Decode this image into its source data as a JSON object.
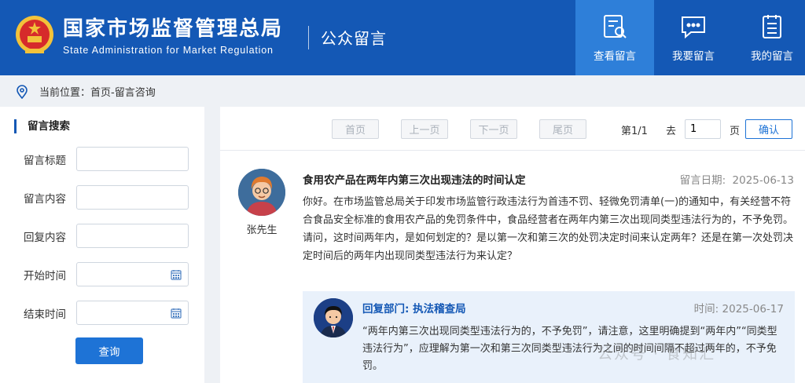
{
  "header": {
    "site_title": "国家市场监督管理总局",
    "site_subtitle": "State Administration for Market Regulation",
    "section_title": "公众留言",
    "nav": [
      {
        "label": "查看留言",
        "icon": "search-doc-icon",
        "active": true
      },
      {
        "label": "我要留言",
        "icon": "chat-bubble-icon",
        "active": false
      },
      {
        "label": "我的留言",
        "icon": "clipboard-list-icon",
        "active": false
      }
    ],
    "colors": {
      "header_bg": "#1458b5",
      "active_nav": "#2e7fd9",
      "accent": "#1e73d6"
    }
  },
  "breadcrumb": {
    "icon": "location-pin-icon",
    "text": "当前位置：首页-留言咨询"
  },
  "sidebar": {
    "title": "留言搜索",
    "fields": [
      {
        "label": "留言标题",
        "value": "",
        "type": "text"
      },
      {
        "label": "留言内容",
        "value": "",
        "type": "text"
      },
      {
        "label": "回复内容",
        "value": "",
        "type": "text"
      },
      {
        "label": "开始时间",
        "value": "",
        "type": "date",
        "icon": "calendar-icon"
      },
      {
        "label": "结束时间",
        "value": "",
        "type": "date",
        "icon": "calendar-icon"
      }
    ],
    "query_label": "查询"
  },
  "pager": {
    "first": "首页",
    "prev": "上一页",
    "next": "下一页",
    "last": "尾页",
    "page_info": "第1/1",
    "goto_label": "去",
    "page_value": "1",
    "page_unit": "页",
    "confirm": "确认"
  },
  "message": {
    "author": "张先生",
    "title": "食用农产品在两年内第三次出现违法的时间认定",
    "date_label": "留言日期:",
    "date": "2025-06-13",
    "body": "你好。在市场监管总局关于印发市场监管行政违法行为首违不罚、轻微免罚清单(一)的通知中，有关经营不符合食品安全标准的食用农产品的免罚条件中，食品经营者在两年内第三次出现同类型违法行为的，不予免罚。\n请问，这时间两年内，是如何划定的？是以第一次和第三次的处罚决定时间来认定两年？还是在第一次处罚决定时间后的两年内出现同类型违法行为来认定？"
  },
  "reply": {
    "dept": "回复部门: 执法稽查局",
    "time_label": "时间:",
    "time": "2025-06-17",
    "body": "“两年内第三次出现同类型违法行为的，不予免罚”，请注意，这里明确提到“两年内”“同类型违法行为”，应理解为第一次和第三次同类型违法行为之间的时间间隔不超过两年的，不予免罚。"
  },
  "watermark": "公众号 · 食知汇"
}
